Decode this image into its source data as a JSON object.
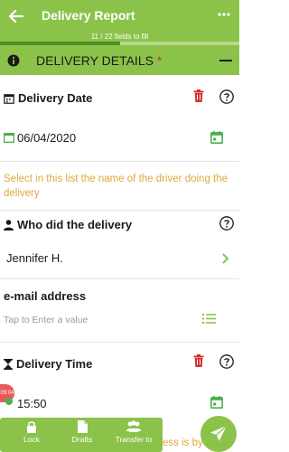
{
  "appbar": {
    "title": "Delivery Report",
    "progress_text": "11 / 22 fields to fill",
    "progress_fraction": 0.5
  },
  "section": {
    "title": "DELIVERY DETAILS",
    "required_mark": "*"
  },
  "fields": {
    "delivery_date": {
      "label": "Delivery Date",
      "value": "06/04/2020"
    },
    "driver_hint": "Select in this list the name of the driver doing the delivery",
    "who": {
      "label": "Who did the delivery",
      "value": "Jennifer H."
    },
    "email": {
      "label": "e-mail address",
      "placeholder": "Tap to Enter a value"
    },
    "delivery_time": {
      "label": "Delivery Time",
      "value": "15:50"
    }
  },
  "bottom_bar": {
    "lock": "Lock",
    "drafts": "Drafts",
    "transfer": "Transfer to"
  },
  "trailing_hint": "ess is by",
  "badge_text": "09:04",
  "colors": {
    "primary": "#8bc34a",
    "hint": "#e0a83a",
    "danger": "#d32f2f",
    "calendar": "#4caf50"
  }
}
